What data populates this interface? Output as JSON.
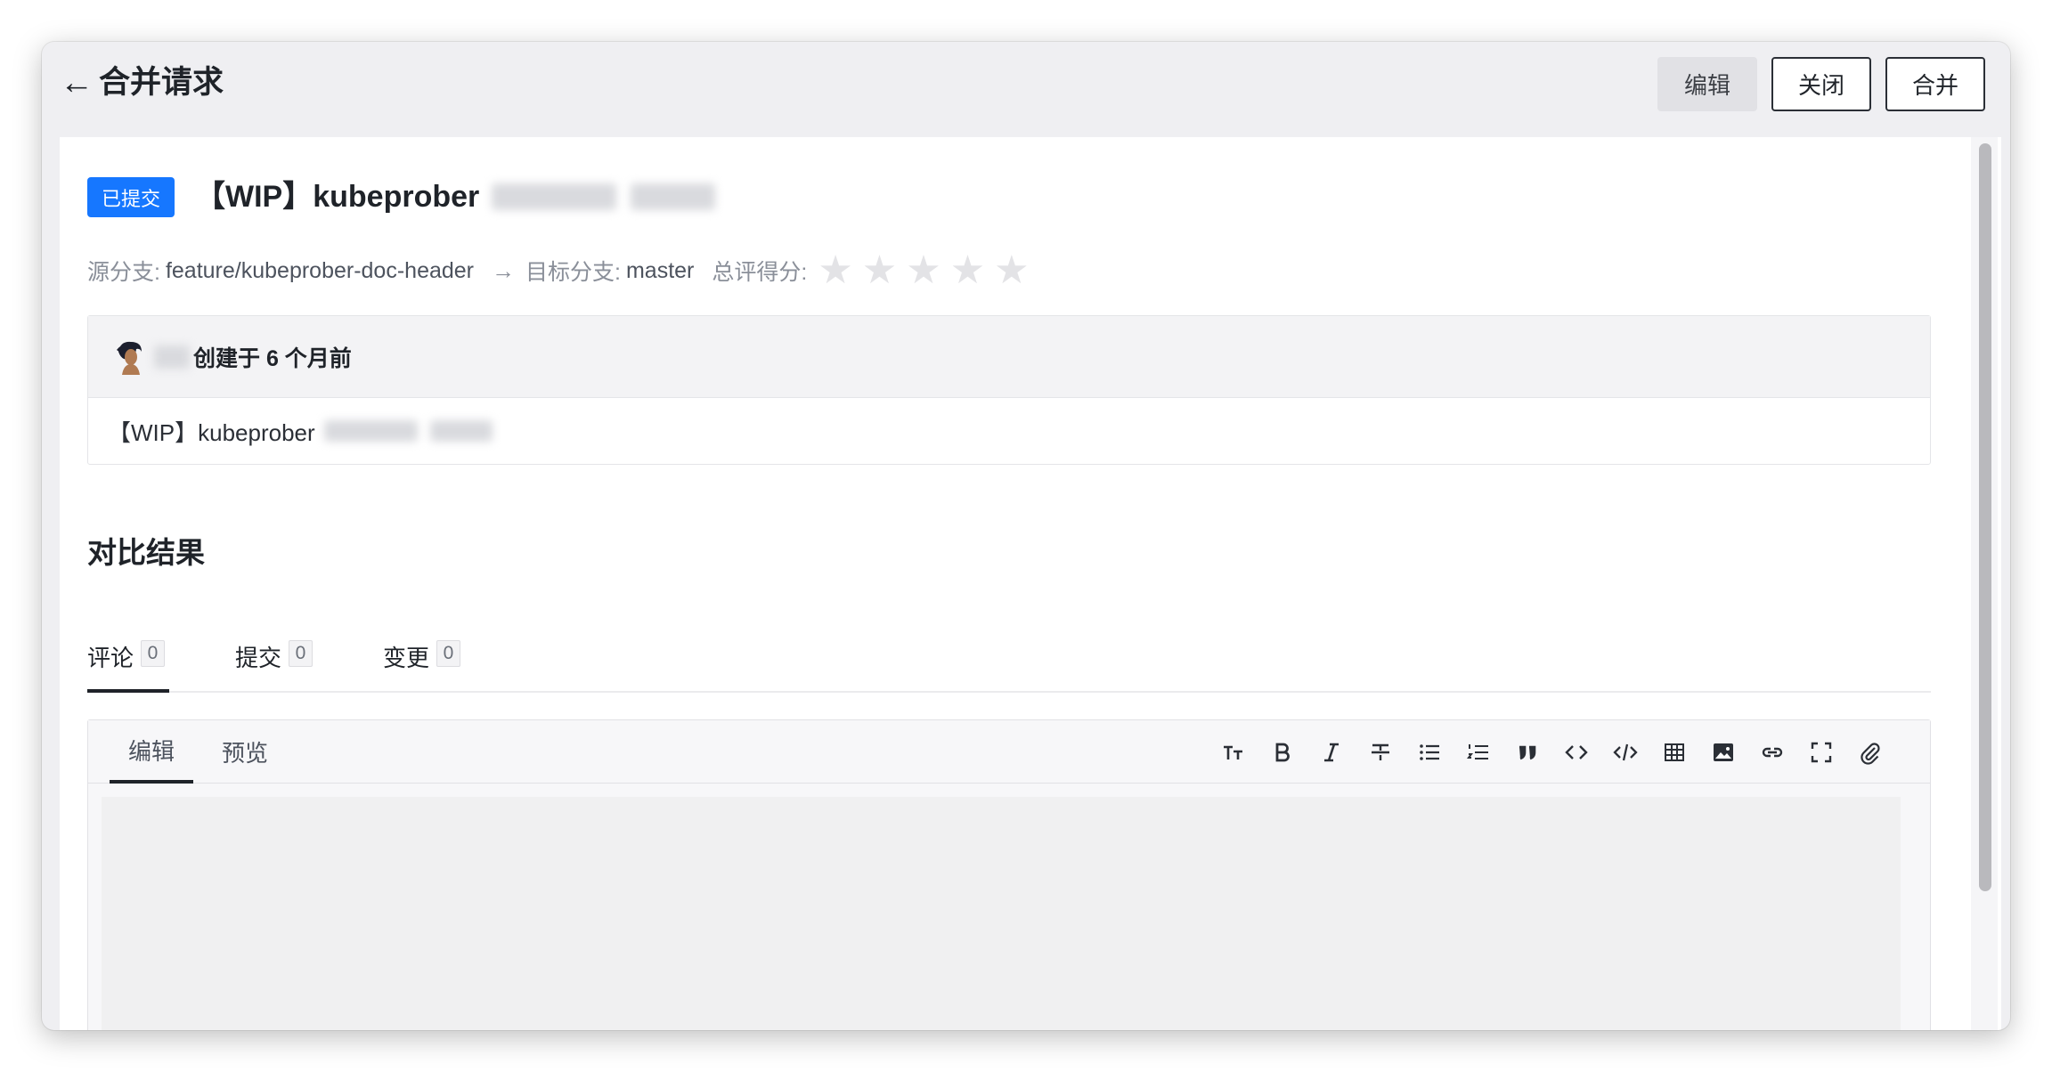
{
  "header": {
    "back_arrow": "←",
    "title": "合并请求",
    "buttons": {
      "edit": "编辑",
      "close": "关闭",
      "merge": "合并"
    }
  },
  "mr": {
    "status": "已提交",
    "title": "【WIP】kubeprober",
    "source_label": "源分支:",
    "source_branch": "feature/kubeprober-doc-header",
    "arrow": "→",
    "target_label": "目标分支:",
    "target_branch": "master",
    "score_label": "总评得分:",
    "stars": [
      "★",
      "★",
      "★",
      "★",
      "★"
    ],
    "author_line": "创建于 6 个月前",
    "description": "【WIP】kubeprober"
  },
  "compare": {
    "title": "对比结果",
    "tabs": [
      {
        "label": "评论",
        "count": "0"
      },
      {
        "label": "提交",
        "count": "0"
      },
      {
        "label": "变更",
        "count": "0"
      }
    ]
  },
  "editor": {
    "tabs": {
      "edit": "编辑",
      "preview": "预览"
    },
    "tools": [
      "text-size-icon",
      "bold-icon",
      "italic-icon",
      "strikethrough-icon",
      "bullet-list-icon",
      "numbered-list-icon",
      "quote-icon",
      "inline-code-icon",
      "code-block-icon",
      "table-icon",
      "image-icon",
      "link-icon",
      "fullscreen-icon",
      "attachment-icon"
    ]
  },
  "colors": {
    "accent": "#1677ff",
    "window_bg": "#efeff2"
  }
}
